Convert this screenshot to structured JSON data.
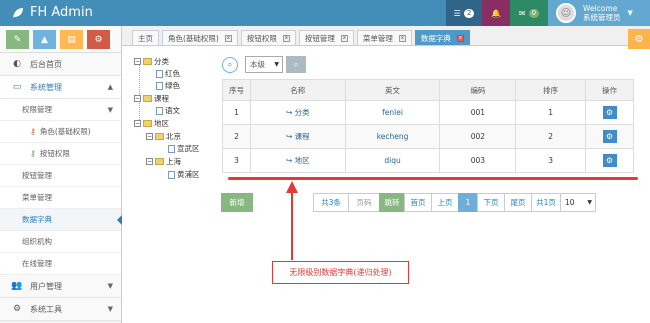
{
  "app": {
    "brand": "FH Admin"
  },
  "navbar": {
    "tasks_count": "2",
    "notifications_count": "",
    "messages_count": "0",
    "user_greeting": "Welcome",
    "user_name": "系统管理员"
  },
  "sidebar": {
    "items": [
      {
        "label": "后台首页",
        "icon": "tachometer-icon"
      },
      {
        "label": "系统管理",
        "icon": "desktop-icon",
        "arrow": "▲"
      },
      {
        "label": "权限管理",
        "arrow": "▼"
      },
      {
        "label": "角色(基础权限)"
      },
      {
        "label": "按钮权限"
      },
      {
        "label": "按钮管理"
      },
      {
        "label": "菜单管理"
      },
      {
        "label": "数据字典"
      },
      {
        "label": "组织机构"
      },
      {
        "label": "在线管理"
      },
      {
        "label": "用户管理",
        "icon": "users-icon",
        "arrow": "▼"
      },
      {
        "label": "系统工具",
        "icon": "gear-icon",
        "arrow": "▼"
      }
    ]
  },
  "tabs": [
    {
      "label": "主页"
    },
    {
      "label": "角色(基础权限)"
    },
    {
      "label": "按钮权限"
    },
    {
      "label": "按钮管理"
    },
    {
      "label": "菜单管理"
    },
    {
      "label": "数据字典"
    }
  ],
  "tree": {
    "nodes": [
      "分类",
      "红色",
      "绿色",
      "课程",
      "语文",
      "地区",
      "北京",
      "宣武区",
      "上海",
      "黄浦区"
    ]
  },
  "toolbar": {
    "level_select": "本级"
  },
  "table": {
    "headers": [
      "序号",
      "名称",
      "英文",
      "编码",
      "排序",
      "操作"
    ],
    "rows": [
      {
        "no": "1",
        "name": "分类",
        "en": "fenlei",
        "code": "001",
        "order": "1"
      },
      {
        "no": "2",
        "name": "课程",
        "en": "kecheng",
        "code": "002",
        "order": "2"
      },
      {
        "no": "3",
        "name": "地区",
        "en": "diqu",
        "code": "003",
        "order": "3"
      }
    ]
  },
  "actions": {
    "add_label": "新增"
  },
  "pagination": {
    "total": "共3条",
    "jump_placeholder": "页码",
    "jump_label": "跳转",
    "first": "首页",
    "prev": "上页",
    "current": "1",
    "next": "下页",
    "last": "尾页",
    "pages": "共1页",
    "page_size": "10"
  },
  "annotation": {
    "text": "无限级别数据字典(递归处理)"
  },
  "colors": {
    "navbar": "#438eb9",
    "annotation": "#e53935",
    "active_tab": "#4f99c6"
  }
}
